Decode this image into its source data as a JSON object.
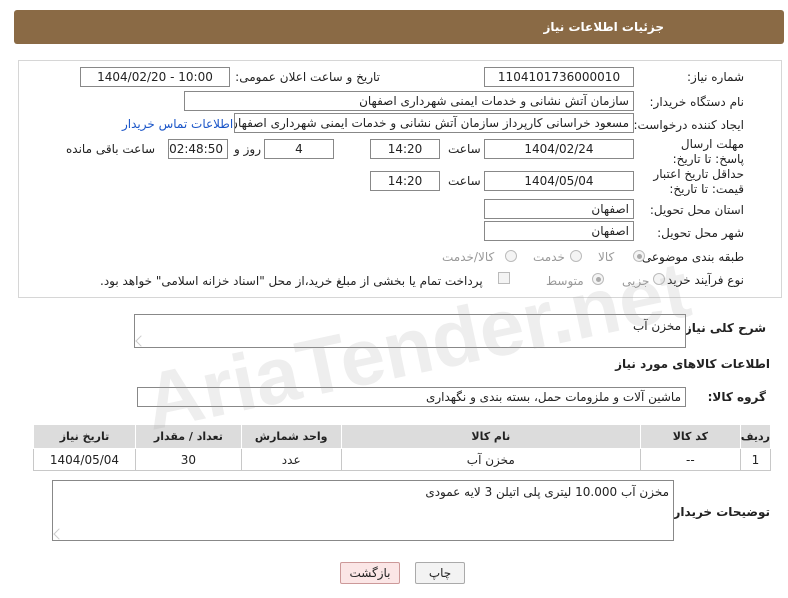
{
  "header": {
    "title": "جزئیات اطلاعات نیاز"
  },
  "form": {
    "need_number_label": "شماره نیاز:",
    "need_number": "1104101736000010",
    "announce_label": "تاریخ و ساعت اعلان عمومی:",
    "announce_value": "1404/02/20 - 10:00",
    "buyer_org_label": "نام دستگاه خریدار:",
    "buyer_org": "سازمان آتش نشانی و خدمات ایمنی شهرداری اصفهان",
    "creator_label": "ایجاد کننده درخواست:",
    "creator": "مسعود خراسانی کارپرداز سازمان آتش نشانی و خدمات ایمنی شهرداری اصفهان",
    "contact_link": "اطلاعات تماس خریدار",
    "deadline_label": "مهلت ارسال پاسخ: تا تاریخ:",
    "deadline_date": "1404/02/24",
    "time_label": "ساعت",
    "deadline_time": "14:20",
    "days_value": "4",
    "days_label": "روز و",
    "remaining_time": "02:48:50",
    "remaining_label": "ساعت باقی مانده",
    "validity_label": "حداقل تاریخ اعتبار قیمت: تا تاریخ:",
    "validity_date": "1404/05/04",
    "validity_time": "14:20",
    "province_label": "استان محل تحویل:",
    "province": "اصفهان",
    "city_label": "شهر محل تحویل:",
    "city": "اصفهان",
    "category_label": "طبقه بندی موضوعی:",
    "category_options": [
      "کالا",
      "خدمت",
      "کالا/خدمت"
    ],
    "process_label": "نوع فرآیند خرید :",
    "process_options": [
      "جزیی",
      "متوسط"
    ],
    "payment_note": "پرداخت تمام یا بخشی از مبلغ خرید،از محل \"اسناد خزانه اسلامی\" خواهد بود."
  },
  "description": {
    "label": "شرح کلی نیاز:",
    "value": "مخزن آب"
  },
  "goods": {
    "section_title": "اطلاعات کالاهای مورد نیاز",
    "group_label": "گروه کالا:",
    "group_value": "ماشین آلات و ملزومات حمل، بسته بندی و نگهداری",
    "columns": [
      "ردیف",
      "کد کالا",
      "نام کالا",
      "واحد شمارش",
      "تعداد / مقدار",
      "تاریخ نیاز"
    ],
    "rows": [
      {
        "row": "1",
        "code": "--",
        "name": "مخزن آب",
        "unit": "عدد",
        "qty": "30",
        "date": "1404/05/04"
      }
    ]
  },
  "buyer_notes": {
    "label": "توضیحات خریدار:",
    "value": "مخزن آب 10.000 لیتری پلی اتیلن 3 لایه عمودی"
  },
  "buttons": {
    "print": "چاپ",
    "back": "بازگشت"
  },
  "watermark": "AriaTender.net"
}
